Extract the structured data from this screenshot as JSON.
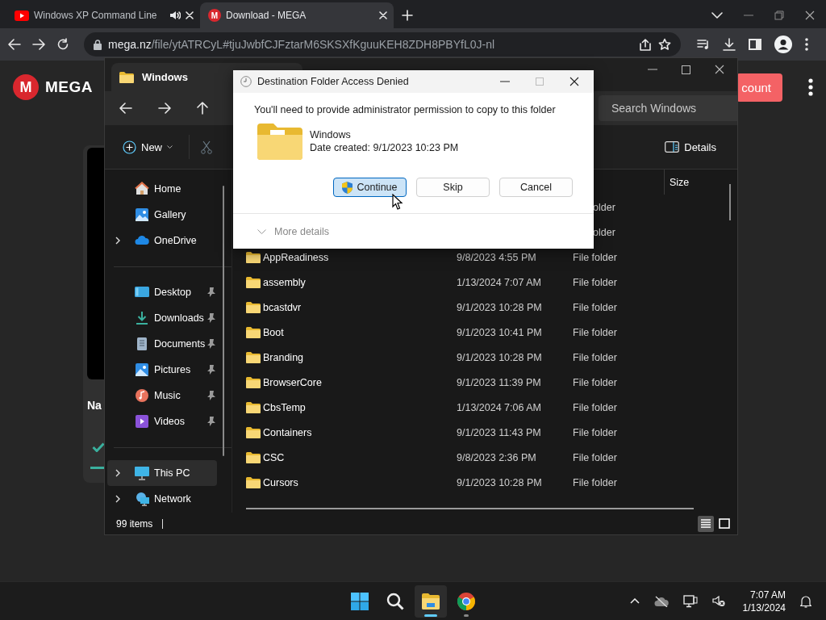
{
  "browser": {
    "tabs": [
      {
        "title": "Windows XP Command Line",
        "selected": false,
        "audio": true,
        "kind": "video"
      },
      {
        "title": "Download - MEGA",
        "selected": true,
        "audio": false,
        "kind": "mega",
        "favicon_mark": "M"
      }
    ],
    "address": {
      "host": "mega.nz",
      "path": "/file/ytATRCyL#tjuJwbfCJFztarM6SKSXfKguuKEH8ZDH8PBYfL0J-nl"
    }
  },
  "page": {
    "logo_mark": "M",
    "logo": "MEGA",
    "account_button": "count",
    "card_label": "Na"
  },
  "explorer": {
    "tab_title": "Windows",
    "search": {
      "placeholder": "Search Windows"
    },
    "toolbar": {
      "new": "New",
      "details": "Details"
    },
    "sidebar": [
      {
        "items": [
          {
            "label": "Home",
            "kind": "home",
            "expandable": false,
            "pinned": false,
            "selected": false
          },
          {
            "label": "Gallery",
            "kind": "gallery",
            "expandable": false,
            "pinned": false,
            "selected": false
          },
          {
            "label": "OneDrive",
            "kind": "cloud",
            "expandable": true,
            "pinned": false,
            "selected": false
          }
        ]
      },
      {
        "items": [
          {
            "label": "Desktop",
            "kind": "desktop",
            "expandable": false,
            "pinned": true,
            "selected": false
          },
          {
            "label": "Downloads",
            "kind": "download",
            "expandable": false,
            "pinned": true,
            "selected": false
          },
          {
            "label": "Documents",
            "kind": "document",
            "expandable": false,
            "pinned": true,
            "selected": false
          },
          {
            "label": "Pictures",
            "kind": "picture",
            "expandable": false,
            "pinned": true,
            "selected": false
          },
          {
            "label": "Music",
            "kind": "music",
            "expandable": false,
            "pinned": true,
            "selected": false
          },
          {
            "label": "Videos",
            "kind": "video",
            "expandable": false,
            "pinned": true,
            "selected": false
          }
        ]
      },
      {
        "items": [
          {
            "label": "This PC",
            "kind": "pc",
            "expandable": true,
            "pinned": false,
            "selected": true
          },
          {
            "label": "Network",
            "kind": "network",
            "expandable": true,
            "pinned": false,
            "selected": false
          }
        ]
      }
    ],
    "columns": [
      {
        "label": "Size"
      }
    ],
    "covered_rows": [
      {
        "type": "older"
      },
      {
        "type": "older"
      }
    ],
    "rows": [
      {
        "name": "AppReadiness",
        "date": "9/8/2023 4:55 PM",
        "type": "File folder"
      },
      {
        "name": "assembly",
        "date": "1/13/2024 7:07 AM",
        "type": "File folder"
      },
      {
        "name": "bcastdvr",
        "date": "9/1/2023 10:28 PM",
        "type": "File folder"
      },
      {
        "name": "Boot",
        "date": "9/1/2023 10:41 PM",
        "type": "File folder"
      },
      {
        "name": "Branding",
        "date": "9/1/2023 10:28 PM",
        "type": "File folder"
      },
      {
        "name": "BrowserCore",
        "date": "9/1/2023 11:39 PM",
        "type": "File folder"
      },
      {
        "name": "CbsTemp",
        "date": "1/13/2024 7:06 AM",
        "type": "File folder"
      },
      {
        "name": "Containers",
        "date": "9/1/2023 11:43 PM",
        "type": "File folder"
      },
      {
        "name": "CSC",
        "date": "9/8/2023 2:36 PM",
        "type": "File folder"
      },
      {
        "name": "Cursors",
        "date": "9/1/2023 10:28 PM",
        "type": "File folder"
      }
    ],
    "status": "99 items",
    "view_modes": [
      {
        "kind": "details",
        "selected": true
      },
      {
        "kind": "tiles",
        "selected": false
      }
    ]
  },
  "dialog": {
    "title": "Destination Folder Access Denied",
    "message": "You'll need to provide administrator permission to copy to this folder",
    "item": {
      "name": "Windows",
      "date": "Date created: 9/1/2023 10:23 PM"
    },
    "buttons": [
      {
        "label": "Continue",
        "kind": "primary"
      },
      {
        "label": "Skip",
        "kind": "normal"
      },
      {
        "label": "Cancel",
        "kind": "normal"
      }
    ],
    "more": "More details"
  },
  "taskbar": {
    "apps": [
      {
        "kind": "start",
        "active": false,
        "running": false
      },
      {
        "kind": "search",
        "active": false,
        "running": false
      },
      {
        "kind": "explorer",
        "active": true,
        "running": true
      },
      {
        "kind": "chrome",
        "active": false,
        "running": true
      }
    ],
    "time": "7:07 AM",
    "date": "1/13/2024"
  }
}
